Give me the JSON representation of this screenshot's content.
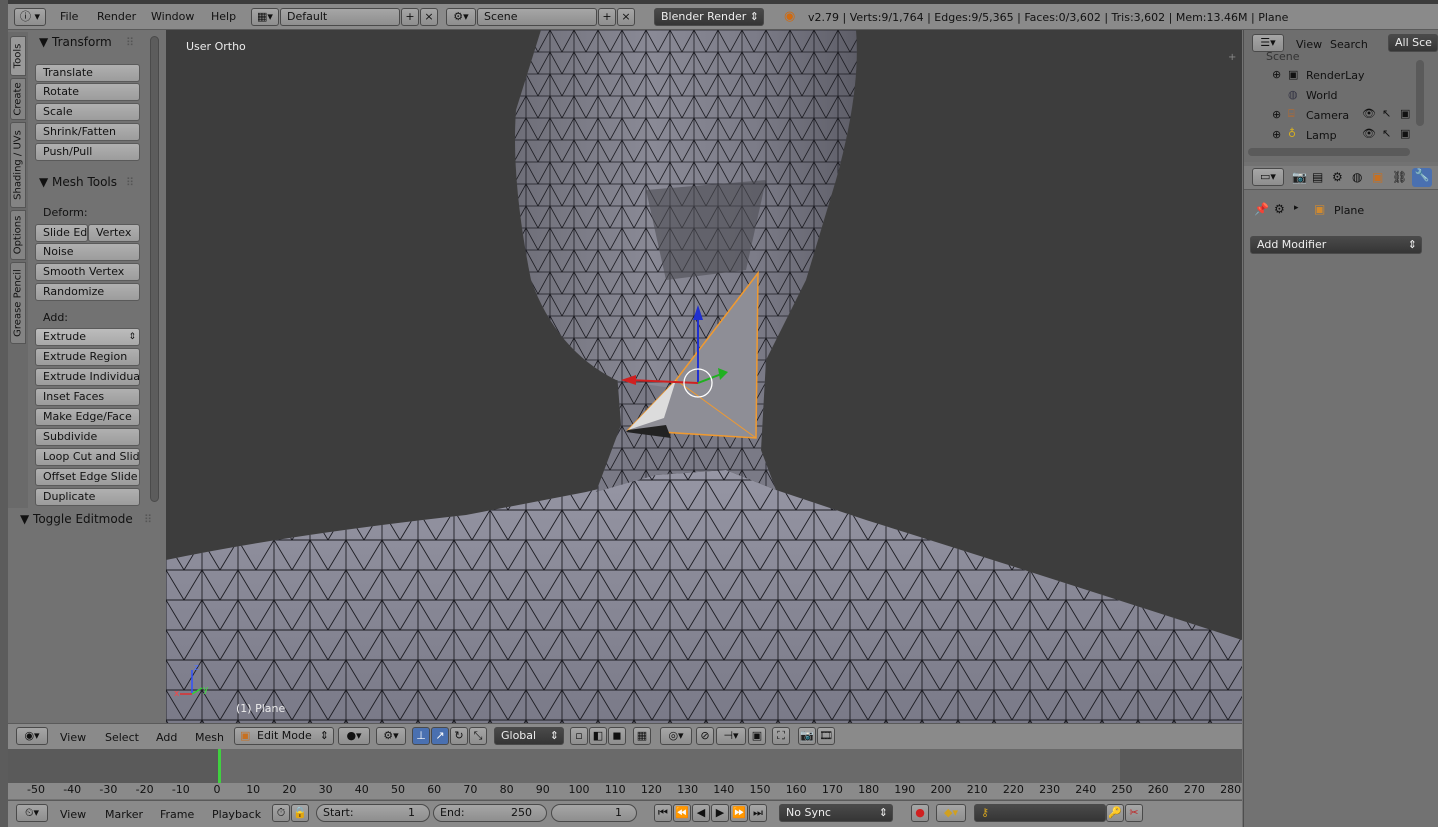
{
  "topbar": {
    "menus": [
      "File",
      "Render",
      "Window",
      "Help"
    ],
    "layout": "Default",
    "scene": "Scene",
    "engine": "Blender Render",
    "stats": "v2.79 | Verts:9/1,764 | Edges:9/5,365 | Faces:0/3,602 | Tris:3,602 | Mem:13.46M | Plane"
  },
  "tabs": [
    "Tools",
    "Create",
    "Shading / UVs",
    "Options",
    "Grease Pencil"
  ],
  "toolshelf": {
    "transform_title": "Transform",
    "transform_tools": [
      "Translate",
      "Rotate",
      "Scale",
      "Shrink/Fatten",
      "Push/Pull"
    ],
    "meshtools_title": "Mesh Tools",
    "deform_label": "Deform:",
    "slide_edge": "Slide Ed",
    "vertex": "Vertex",
    "deform_tools": [
      "Noise",
      "Smooth Vertex",
      "Randomize"
    ],
    "add_label": "Add:",
    "extrude": "Extrude",
    "add_tools": [
      "Extrude Region",
      "Extrude Individual",
      "Inset Faces",
      "Make Edge/Face",
      "Subdivide",
      "Loop Cut and Slide",
      "Offset Edge Slide",
      "Duplicate"
    ],
    "toggle_title": "Toggle Editmode"
  },
  "viewport": {
    "view_label": "User Ortho",
    "object_label": "(1) Plane"
  },
  "outliner": {
    "view": "View",
    "search": "Search",
    "scope": "All Sce",
    "scene_item": "Scene",
    "items": [
      "RenderLay",
      "World",
      "Camera",
      "Lamp"
    ]
  },
  "properties": {
    "object_name": "Plane",
    "add_modifier": "Add Modifier"
  },
  "vp_header": {
    "menus": [
      "View",
      "Select",
      "Add",
      "Mesh"
    ],
    "mode": "Edit Mode",
    "orientation": "Global"
  },
  "timeline": {
    "ticks": [
      "-50",
      "-40",
      "-30",
      "-20",
      "-10",
      "0",
      "10",
      "20",
      "30",
      "40",
      "50",
      "60",
      "70",
      "80",
      "90",
      "100",
      "110",
      "120",
      "130",
      "140",
      "150",
      "160",
      "170",
      "180",
      "190",
      "200",
      "210",
      "220",
      "230",
      "240",
      "250",
      "260",
      "270",
      "280"
    ],
    "menus": [
      "View",
      "Marker",
      "Frame",
      "Playback"
    ],
    "start_label": "Start:",
    "start_value": "1",
    "end_label": "End:",
    "end_value": "250",
    "current": "1",
    "sync": "No Sync"
  },
  "colors": {
    "selection": "#f09a30",
    "viewport_bg": "#3d3d3d",
    "mesh_face": "#8c8c9c"
  }
}
